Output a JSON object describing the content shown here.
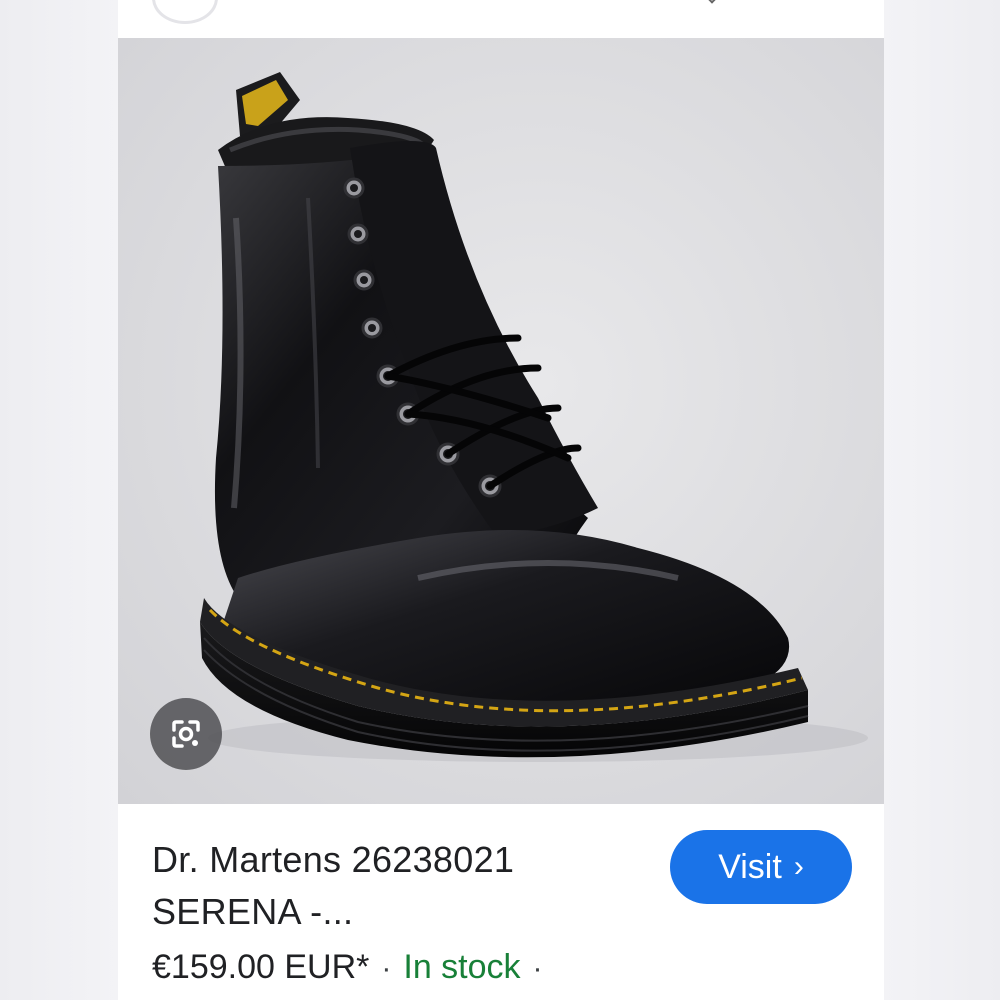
{
  "product": {
    "title_line1": "Dr. Martens 26238021",
    "title_line2": "SERENA -...",
    "price": "€159.00 EUR*",
    "separator": "·",
    "stock_status": "In stock",
    "trailing_separator": "·"
  },
  "actions": {
    "visit_label": "Visit",
    "visit_chevron": "›"
  },
  "icons": {
    "lens": "google-lens-icon",
    "avatar": "avatar-icon"
  },
  "colors": {
    "visit_button": "#1a73e8",
    "in_stock": "#188038",
    "text": "#202124"
  }
}
